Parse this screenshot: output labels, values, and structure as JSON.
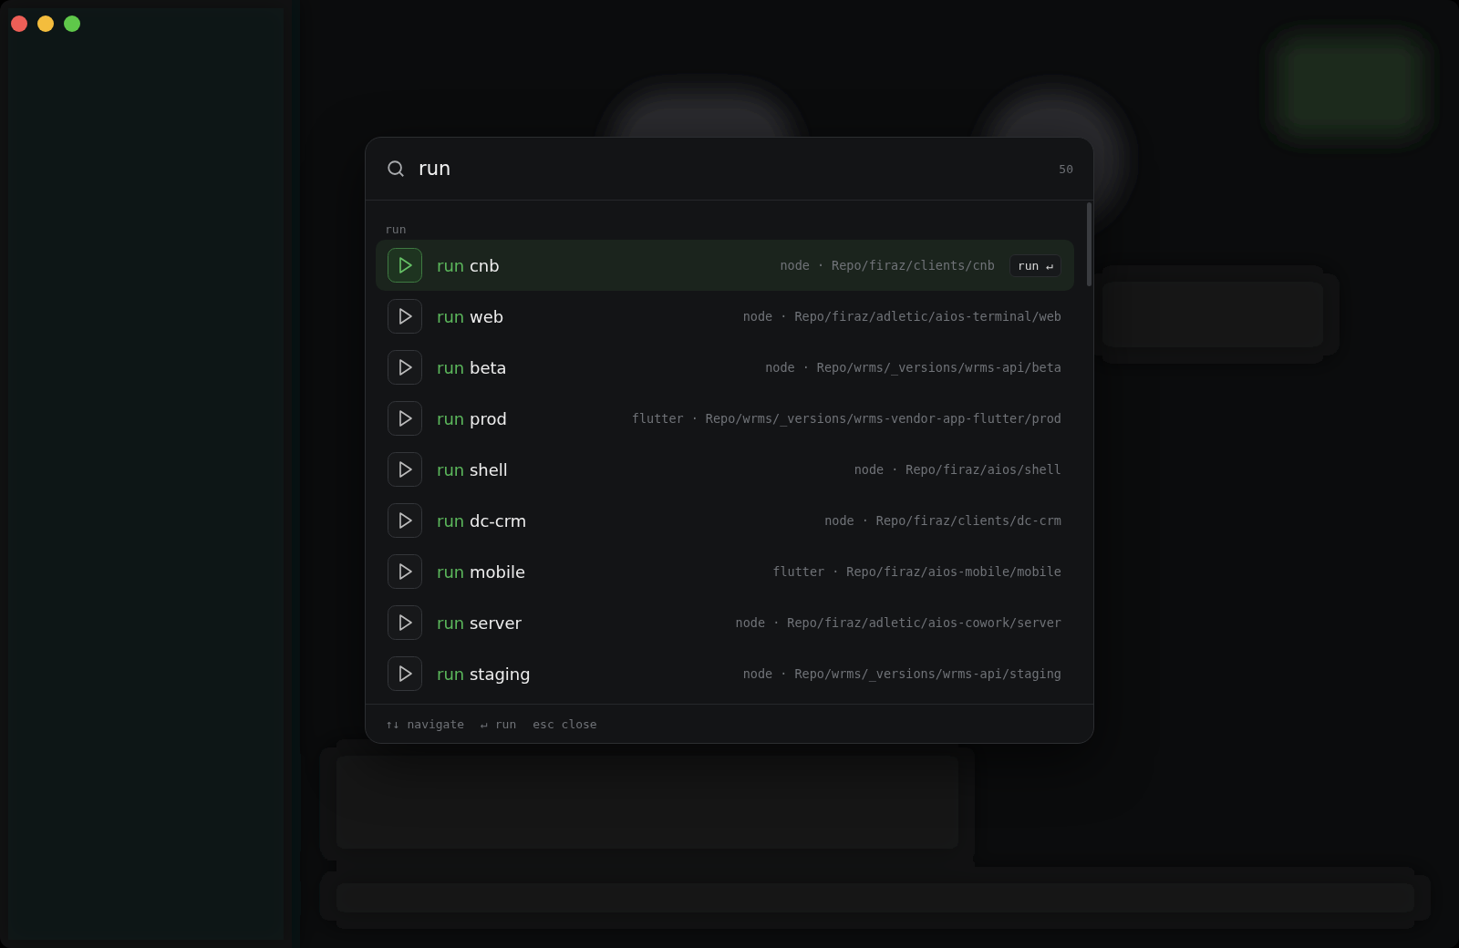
{
  "search": {
    "value": "run",
    "count": "50"
  },
  "group": {
    "label": "run"
  },
  "separator": "·",
  "items": [
    {
      "match": "run",
      "name": "cnb",
      "runtime": "node",
      "path": "Repo/firaz/clients/cnb",
      "selected": true,
      "hint": "run ↵"
    },
    {
      "match": "run",
      "name": "web",
      "runtime": "node",
      "path": "Repo/firaz/adletic/aios-terminal/web",
      "selected": false
    },
    {
      "match": "run",
      "name": "beta",
      "runtime": "node",
      "path": "Repo/wrms/_versions/wrms-api/beta",
      "selected": false
    },
    {
      "match": "run",
      "name": "prod",
      "runtime": "flutter",
      "path": "Repo/wrms/_versions/wrms-vendor-app-flutter/prod",
      "selected": false
    },
    {
      "match": "run",
      "name": "shell",
      "runtime": "node",
      "path": "Repo/firaz/aios/shell",
      "selected": false
    },
    {
      "match": "run",
      "name": "dc-crm",
      "runtime": "node",
      "path": "Repo/firaz/clients/dc-crm",
      "selected": false
    },
    {
      "match": "run",
      "name": "mobile",
      "runtime": "flutter",
      "path": "Repo/firaz/aios-mobile/mobile",
      "selected": false
    },
    {
      "match": "run",
      "name": "server",
      "runtime": "node",
      "path": "Repo/firaz/adletic/aios-cowork/server",
      "selected": false
    },
    {
      "match": "run",
      "name": "staging",
      "runtime": "node",
      "path": "Repo/wrms/_versions/wrms-api/staging",
      "selected": false
    }
  ],
  "footer": [
    {
      "keys": "↑↓",
      "action": "navigate"
    },
    {
      "keys": "↵",
      "action": "run"
    },
    {
      "keys": "esc",
      "action": "close"
    }
  ]
}
